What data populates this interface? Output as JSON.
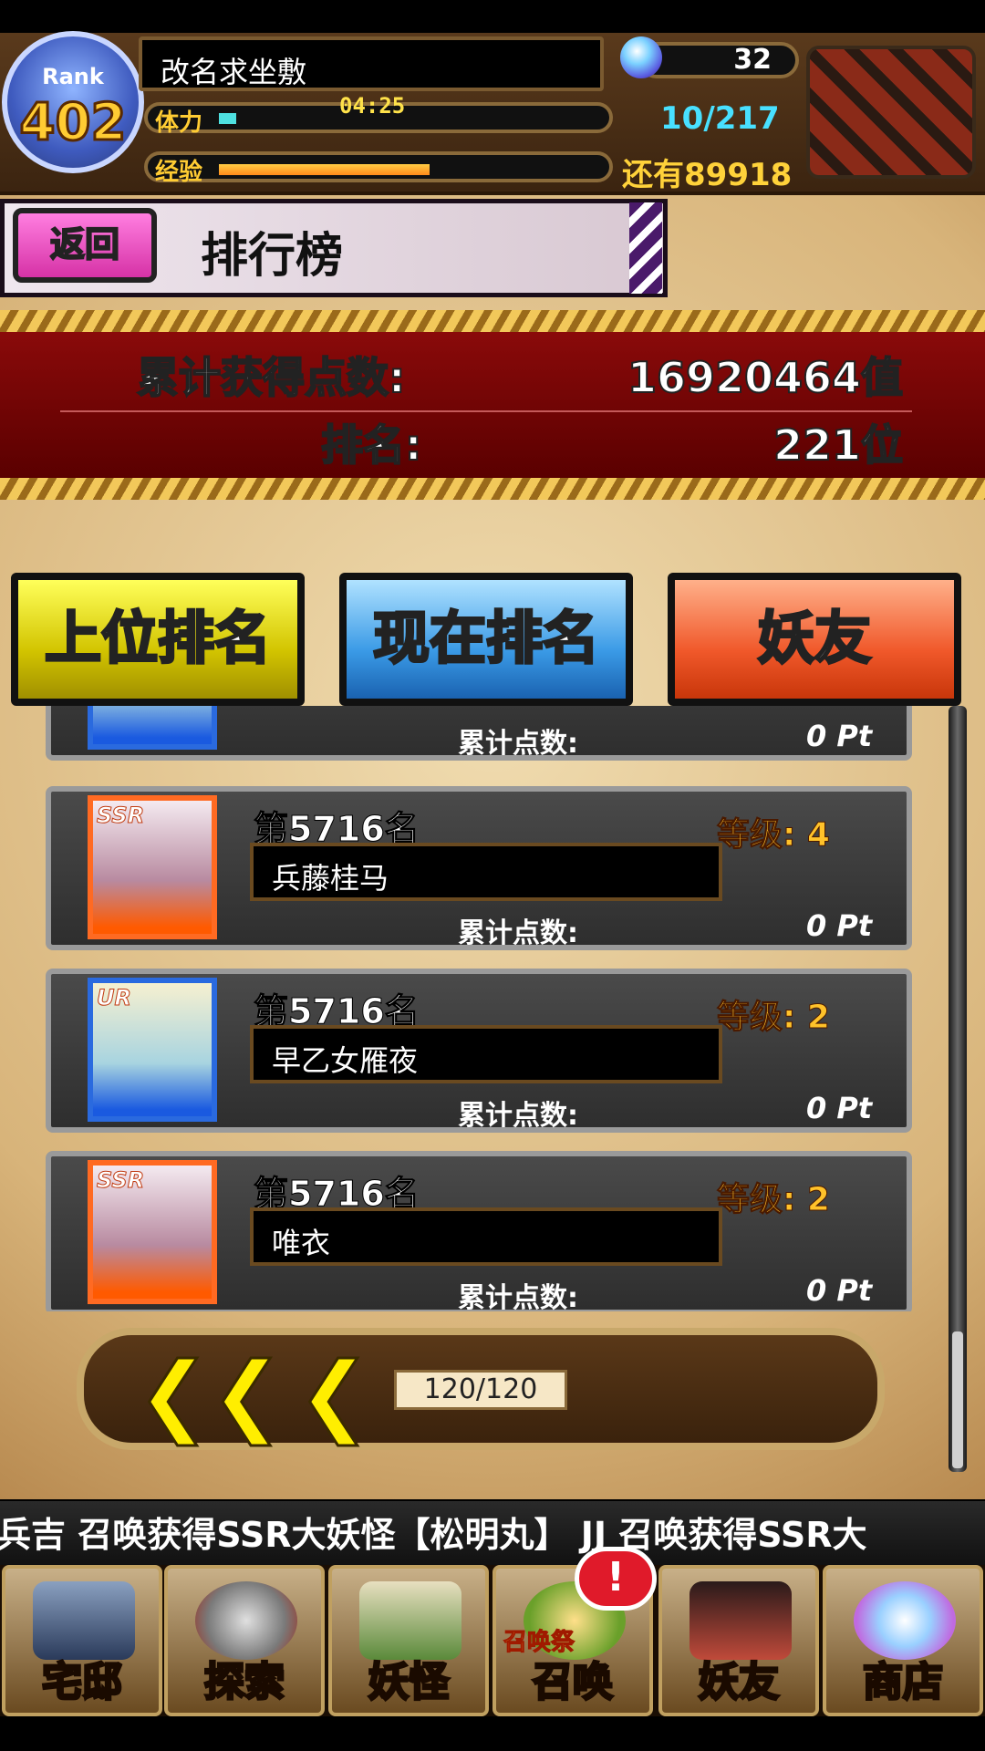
{
  "header": {
    "rank_label": "Rank",
    "rank_value": "402",
    "player_name": "改名求坐敷",
    "stamina_label": "体力",
    "stamina_timer": "04:25",
    "stamina_count": "10/217",
    "stamina_fraction": 0.046,
    "exp_label": "经验",
    "exp_remaining": "还有89918",
    "exp_fraction": 0.55,
    "gem_count": "32"
  },
  "title_bar": {
    "back_label": "返回",
    "title": "排行榜"
  },
  "stats": {
    "points_label": "累计获得点数:",
    "points_value": "16920464值",
    "rank_label": "排名:",
    "rank_value": "221位"
  },
  "tabs": [
    {
      "label": "上位排名"
    },
    {
      "label": "现在排名"
    },
    {
      "label": "妖友"
    }
  ],
  "list": {
    "partial_card": {
      "pt_label": "累计点数:",
      "pt_value": "0 Pt"
    },
    "cards": [
      {
        "rarity": "SSR",
        "rank": "第5716名",
        "level": "等级: 4",
        "name": "兵藤桂马",
        "pt_label": "累计点数:",
        "pt_value": "0 Pt"
      },
      {
        "rarity": "UR",
        "rank": "第5716名",
        "level": "等级: 2",
        "name": "早乙女雁夜",
        "pt_label": "累计点数:",
        "pt_value": "0 Pt"
      },
      {
        "rarity": "SSR",
        "rank": "第5716名",
        "level": "等级: 2",
        "name": "唯衣",
        "pt_label": "累计点数:",
        "pt_value": "0 Pt"
      }
    ]
  },
  "pager": {
    "first_glyph": "❮❮",
    "prev_glyph": "❮",
    "page": "120/120"
  },
  "ticker": {
    "text": "兵吉 召唤获得SSR大妖怪【松明丸】    JJ 召唤获得SSR大"
  },
  "nav": {
    "home": "宅邸",
    "explore": "探索",
    "yokai": "妖怪",
    "summon": "召唤",
    "summon_fest": "召唤祭",
    "friends": "妖友",
    "shop": "商店",
    "alert": "!"
  },
  "colors": {
    "banner_red": "#7a0a0a",
    "tab_yellow": "#d2c400",
    "tab_blue": "#3a9ae6",
    "tab_orange": "#f0582a",
    "level_gold": "#ffc22a"
  }
}
